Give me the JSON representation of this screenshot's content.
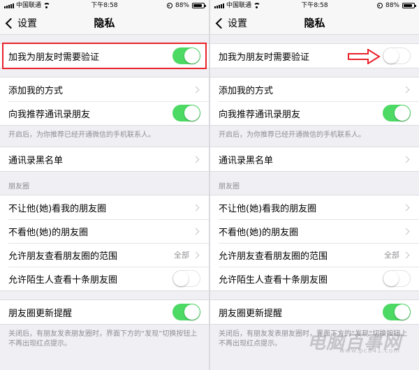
{
  "statusbar": {
    "carrier": "中国联通",
    "time": "下午8:58",
    "battery": "88%",
    "battery_level": 0.88
  },
  "navbar": {
    "back_label": "设置",
    "title": "隐私"
  },
  "rows": {
    "verify": "加我为朋友时需要验证",
    "add_methods": "添加我的方式",
    "recommend_contacts": "向我推荐通讯录朋友",
    "recommend_note": "开启后，为你推荐已经开通微信的手机联系人。",
    "blacklist": "通讯录黑名单",
    "moments_header": "朋友圈",
    "block_view": "不让他(她)看我的朋友圈",
    "hide_their": "不看他(她)的朋友圈",
    "range": "允许朋友查看朋友圈的范围",
    "range_value": "全部",
    "stranger_view": "允许陌生人查看十条朋友圈",
    "update_notify": "朋友圈更新提醒",
    "update_note": "关闭后，有朋友发表朋友圈时，界面下方的“发现”切换按钮上不再出现红点提示。"
  },
  "left_toggles": {
    "verify": true,
    "recommend_contacts": true,
    "stranger_view": false,
    "update_notify": true
  },
  "right_toggles": {
    "verify": false,
    "recommend_contacts": true,
    "stranger_view": false,
    "update_notify": true
  },
  "colors": {
    "toggle_on": "#4cd964",
    "highlight": "#e8212a",
    "background": "#efeff4"
  },
  "watermark": {
    "text": "电脑百事网",
    "sub": "www.pc841.com"
  }
}
